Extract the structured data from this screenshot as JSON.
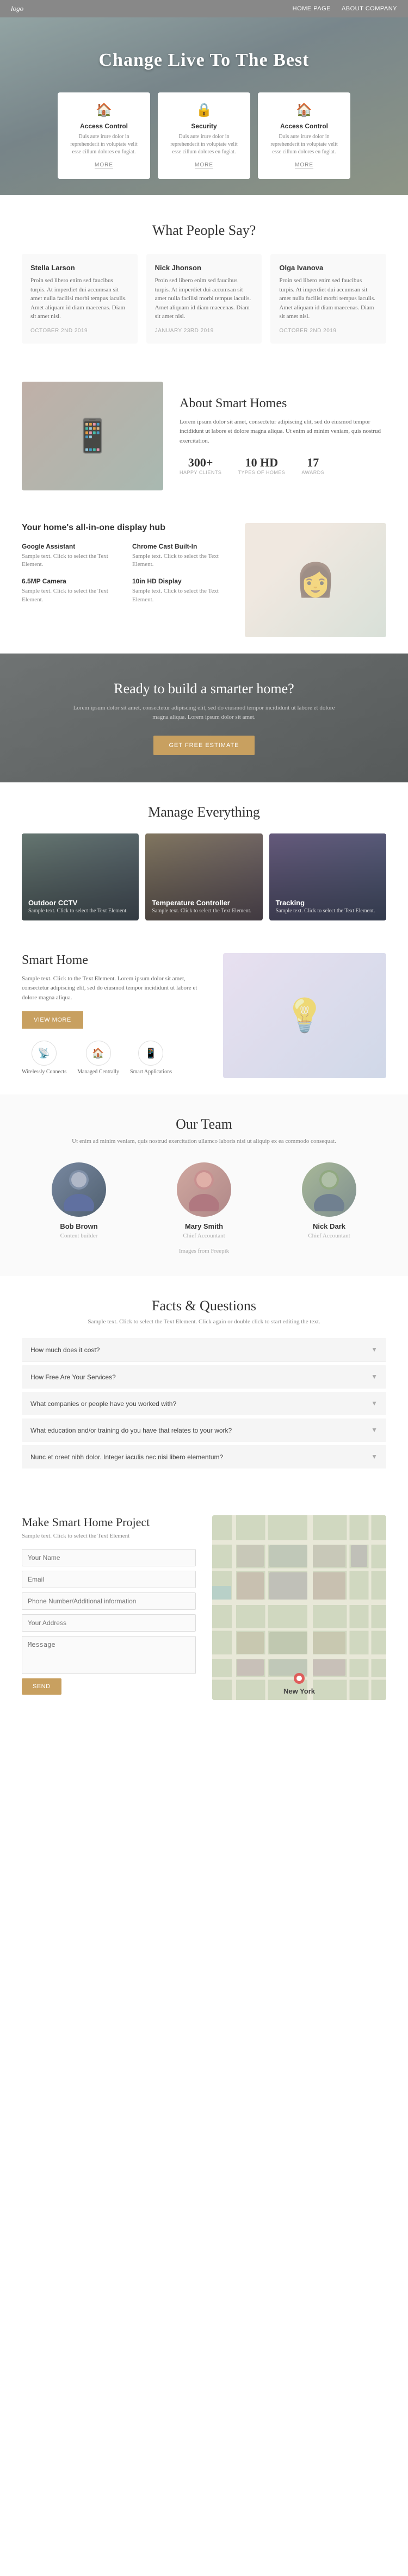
{
  "nav": {
    "logo": "logo",
    "links": [
      "HOME PAGE",
      "ABOUT COMPANY"
    ]
  },
  "hero": {
    "title": "Change Live To The Best",
    "cards": [
      {
        "icon": "🏠",
        "title": "Access Control",
        "text": "Duis aute irure dolor in reprehenderit in voluptate velit esse cillum dolores eu fugiat.",
        "link": "MORE"
      },
      {
        "icon": "🔒",
        "title": "Security",
        "text": "Duis aute irure dolor in reprehenderit in voluptate velit esse cillum dolores eu fugiat.",
        "link": "MORE"
      },
      {
        "icon": "🏠",
        "title": "Access Control",
        "text": "Duis aute irure dolor in reprehenderit in voluptate velit esse cillum dolores eu fugiat.",
        "link": "MORE"
      }
    ]
  },
  "testimonials": {
    "section_title": "What People Say?",
    "items": [
      {
        "name": "Stella Larson",
        "text": "Proin sed libero enim sed faucibus turpis. At imperdiet dui accumsan sit amet nulla facilisi morbi tempus iaculis. Amet aliquam id diam maecenas. Diam sit amet nisl.",
        "date": "OCTOBER 2ND 2019"
      },
      {
        "name": "Nick Jhonson",
        "text": "Proin sed libero enim sed faucibus turpis. At imperdiet dui accumsan sit amet nulla facilisi morbi tempus iaculis. Amet aliquam id diam maecenas. Diam sit amet nisl.",
        "date": "JANUARY 23RD 2019"
      },
      {
        "name": "Olga Ivanova",
        "text": "Proin sed libero enim sed faucibus turpis. At imperdiet dui accumsan sit amet nulla facilisi morbi tempus iaculis. Amet aliquam id diam maecenas. Diam sit amet nisl.",
        "date": "OCTOBER 2ND 2019"
      }
    ]
  },
  "about": {
    "title": "About Smart Homes",
    "text": "Lorem ipsum dolor sit amet, consectetur adipiscing elit, sed do eiusmod tempor incididunt ut labore et dolore magna aliqua. Ut enim ad minim veniam, quis nostrud exercitation.",
    "stats": [
      {
        "number": "300+",
        "label": "HAPPY CLIENTS"
      },
      {
        "number": "10 HD",
        "label": "TYPES OF HOMES"
      },
      {
        "number": "17",
        "label": "AWARDS"
      }
    ]
  },
  "hub": {
    "title": "Your home's all-in-one display hub",
    "items": [
      {
        "title": "Google Assistant",
        "text": "Sample text. Click to select the Text Element."
      },
      {
        "title": "Chrome Cast Built-In",
        "text": "Sample text. Click to select the Text Element."
      },
      {
        "title": "6.5MP Camera",
        "text": "Sample text. Click to select the Text Element."
      },
      {
        "title": "10in HD Display",
        "text": "Sample text. Click to select the Text Element."
      }
    ]
  },
  "cta": {
    "title": "Ready to build a smarter home?",
    "text": "Lorem ipsum dolor sit amet, consectetur adipiscing elit, sed do eiusmod tempor incididunt ut labore et dolore magna aliqua. Lorem ipsum dolor sit amet.",
    "button": "GET FREE ESTIMATE"
  },
  "manage": {
    "section_title": "Manage Everything",
    "cards": [
      {
        "title": "Outdoor CCTV",
        "text": "Sample text. Click to select the Text Element.",
        "type": "outdoor"
      },
      {
        "title": "Temperature Controller",
        "text": "Sample text. Click to select the Text Element.",
        "type": "temperature"
      },
      {
        "title": "Tracking",
        "text": "Sample text. Click to select the Text Element.",
        "type": "tracking"
      }
    ]
  },
  "smart": {
    "title": "Smart Home",
    "text": "Sample text. Click to the Text Element. Lorem ipsum dolor sit amet, consectetur adipiscing elit, sed do eiusmod tempor incididunt ut labore et dolore magna aliqua.",
    "button": "VIEW MORE",
    "icons": [
      {
        "icon": "📡",
        "label": "Wirelessly Connects"
      },
      {
        "icon": "🏠",
        "label": "Managed Centrally"
      },
      {
        "icon": "📱",
        "label": "Smart Applications"
      }
    ]
  },
  "team": {
    "section_title": "Our Team",
    "subtitle": "Ut enim ad minim veniam, quis nostrud exercitation ullamco laboris nisi ut aliquip ex ea commodo consequat.",
    "members": [
      {
        "name": "Bob Brown",
        "role": "Content builder",
        "avatar": "bob"
      },
      {
        "name": "Mary Smith",
        "role": "Chief Accountant",
        "avatar": "mary"
      },
      {
        "name": "Nick Dark",
        "role": "Chief Accountant",
        "avatar": "nick"
      }
    ],
    "credit": "Images from Freepik"
  },
  "faq": {
    "section_title": "Facts & Questions",
    "subtitle": "Sample text. Click to select the Text Element. Click again or double click to start editing the text.",
    "questions": [
      "How much does it cost?",
      "How Free Are Your Services?",
      "What companies or people have you worked with?",
      "What education and/or training do you have that relates to your work?",
      "Nunc et oreet nibh dolor. Integer iaculis nec nisi libero elementum?"
    ]
  },
  "contact": {
    "section_title": "Make Smart Home Project",
    "subtitle": "Sample text. Click to select the Text Element",
    "form": {
      "name_placeholder": "Your Name",
      "email_placeholder": "Email",
      "phone_placeholder": "Phone Number/Additional information",
      "address_placeholder": "Your Address",
      "message_placeholder": "Message",
      "submit_label": "SEND"
    },
    "map_label": "New York"
  }
}
